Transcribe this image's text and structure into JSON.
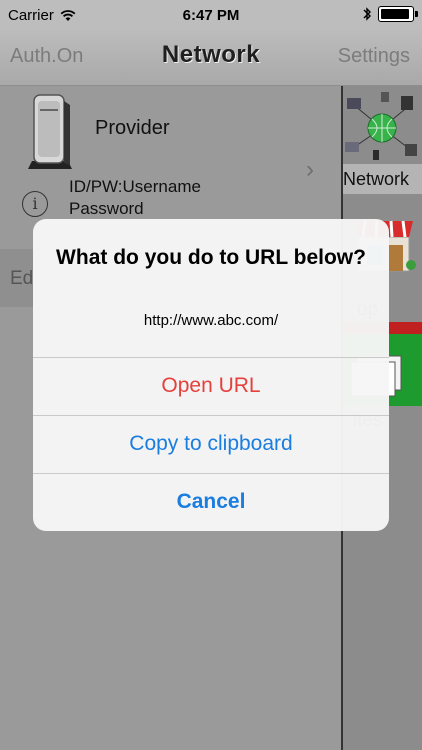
{
  "status_bar": {
    "carrier": "Carrier",
    "time": "6:47 PM",
    "wifi_icon": "wifi-icon",
    "bluetooth_icon": "bluetooth-icon",
    "battery_icon": "battery-icon",
    "battery_level": 1.0
  },
  "nav": {
    "left": "Auth.On",
    "title": "Network",
    "right": "Settings"
  },
  "table": {
    "provider_label": "Provider",
    "auth_id": "ID/PW:Username",
    "auth_pw": "Password",
    "edit_label": "Ed"
  },
  "side_pane": {
    "network_label": "Network",
    "shop_label": "op",
    "favorites_label": "ites"
  },
  "alert": {
    "title": "What do you do to URL below?",
    "message": "http://www.abc.com/",
    "buttons": {
      "open_url": "Open URL",
      "copy": "Copy to clipboard",
      "cancel": "Cancel"
    },
    "colors": {
      "destructive": "#e5413c",
      "default": "#1a7de0"
    }
  }
}
